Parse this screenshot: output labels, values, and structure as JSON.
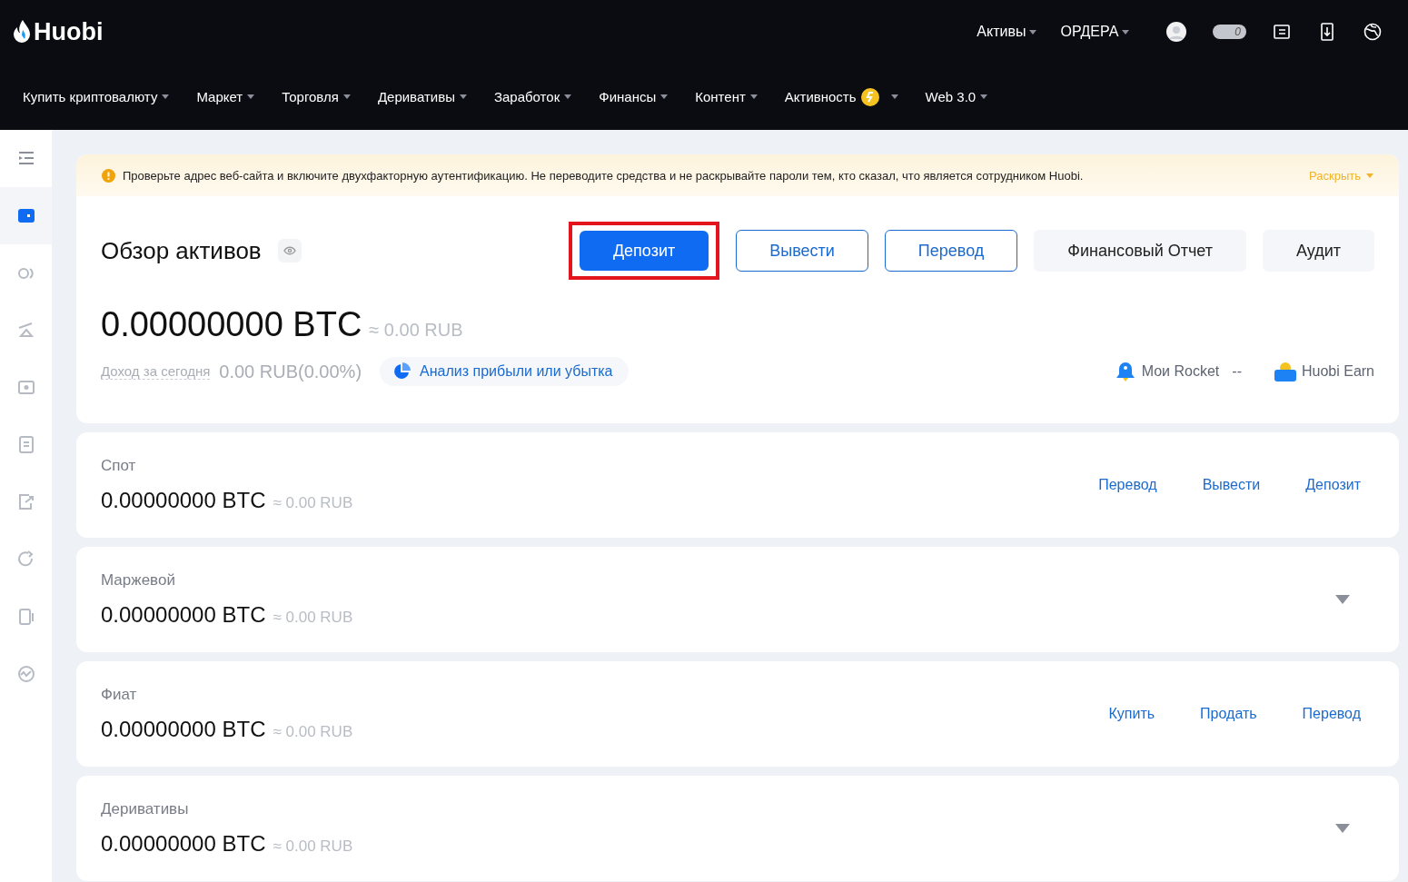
{
  "brand": {
    "name": "Huobi"
  },
  "top_menu": [
    {
      "label": "Активы"
    },
    {
      "label": "ОРДЕРА"
    }
  ],
  "top_icons": [
    {
      "kind": "avatar"
    },
    {
      "kind": "toggle",
      "label": "0"
    },
    {
      "kind": "orders"
    },
    {
      "kind": "download"
    },
    {
      "kind": "globe"
    }
  ],
  "nav": [
    {
      "label": "Купить криптовалюту",
      "badge": false
    },
    {
      "label": "Маркет",
      "badge": false
    },
    {
      "label": "Торговля",
      "badge": false
    },
    {
      "label": "Деривативы",
      "badge": false
    },
    {
      "label": "Заработок",
      "badge": false
    },
    {
      "label": "Финансы",
      "badge": false
    },
    {
      "label": "Контент",
      "badge": false
    },
    {
      "label": "Активность",
      "badge": true
    },
    {
      "label": "Web 3.0",
      "badge": false
    }
  ],
  "sidebar": {
    "items": [
      {
        "kind": "menu",
        "selected": false
      },
      {
        "kind": "wallet",
        "selected": true
      },
      {
        "kind": "swap",
        "selected": false
      },
      {
        "kind": "margin",
        "selected": false
      },
      {
        "kind": "fiat",
        "selected": false
      },
      {
        "kind": "doc",
        "selected": false
      },
      {
        "kind": "export",
        "selected": false
      },
      {
        "kind": "earn",
        "selected": false
      },
      {
        "kind": "phone",
        "selected": false
      },
      {
        "kind": "chart",
        "selected": false
      }
    ]
  },
  "notice": {
    "text": "Проверьте адрес веб-сайта и включите двухфакторную аутентификацию. Не переводите средства и не раскрывайте пароли тем, кто сказал, что является сотрудником Huobi.",
    "expand": "Раскрыть"
  },
  "overview": {
    "title": "Обзор активов",
    "buttons": [
      {
        "label": "Депозит",
        "kind": "primary",
        "highlighted": true
      },
      {
        "label": "Вывести",
        "kind": "outline",
        "highlighted": false
      },
      {
        "label": "Перевод",
        "kind": "outline",
        "highlighted": false
      },
      {
        "label": "Финансовый Отчет",
        "kind": "plain",
        "highlighted": false
      },
      {
        "label": "Аудит",
        "kind": "plain",
        "highlighted": false
      }
    ],
    "balance": "0.00000000 BTC",
    "fiat": "≈ 0.00 RUB",
    "today_label": "Доход за сегодня",
    "today_value": "0.00 RUB(0.00%)",
    "pnl_link": "Анализ прибыли или убытка",
    "rocket_label": "Мои Rocket",
    "rocket_value": "--",
    "earn_label": "Huobi Earn"
  },
  "accounts": [
    {
      "name": "Спот",
      "balance": "0.00000000 BTC",
      "fiat": "≈ 0.00 RUB",
      "kind": "actions",
      "actions": [
        "Перевод",
        "Вывести",
        "Депозит"
      ]
    },
    {
      "name": "Маржевой",
      "balance": "0.00000000 BTC",
      "fiat": "≈ 0.00 RUB",
      "kind": "collapsible",
      "expanded": false
    },
    {
      "name": "Фиат",
      "balance": "0.00000000 BTC",
      "fiat": "≈ 0.00 RUB",
      "kind": "actions",
      "actions": [
        "Купить",
        "Продать",
        "Перевод"
      ]
    },
    {
      "name": "Деривативы",
      "balance": "0.00000000 BTC",
      "fiat": "≈ 0.00 RUB",
      "kind": "collapsible",
      "expanded": false
    }
  ]
}
